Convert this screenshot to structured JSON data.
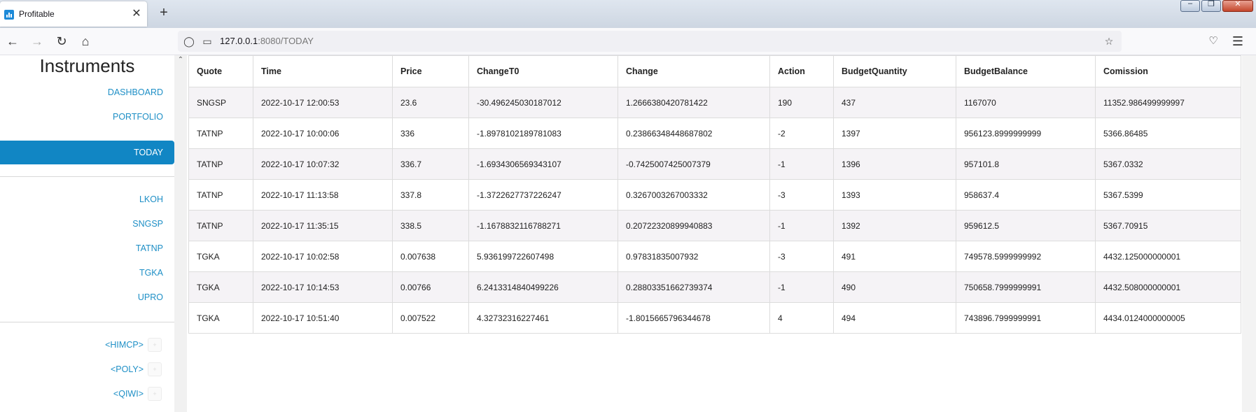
{
  "browser": {
    "tab_title": "Profitable",
    "tab_close_glyph": "✕",
    "new_tab_glyph": "+",
    "url_host": "127.0.0.1",
    "url_rest": ":8080/TODAY",
    "window_controls": {
      "minimize": "–",
      "restore": "❐",
      "close": "✕"
    }
  },
  "sidebar": {
    "title": "Instruments",
    "nav": [
      {
        "label": "DASHBOARD"
      },
      {
        "label": "PORTFOLIO"
      },
      {
        "label": "TODAY",
        "active": true
      }
    ],
    "instruments": [
      {
        "label": "LKOH"
      },
      {
        "label": "SNGSP"
      },
      {
        "label": "TATNP"
      },
      {
        "label": "TGKA"
      },
      {
        "label": "UPRO"
      }
    ],
    "extras": [
      {
        "label": "<HIMCP>",
        "mini": "+"
      },
      {
        "label": "<POLY>",
        "mini": "+"
      },
      {
        "label": "<QIWI>",
        "mini": "+"
      }
    ]
  },
  "table": {
    "columns": [
      "Quote",
      "Time",
      "Price",
      "ChangeT0",
      "Change",
      "Action",
      "BudgetQuantity",
      "BudgetBalance",
      "Comission"
    ],
    "rows": [
      [
        "SNGSP",
        "2022-10-17 12:00:53",
        "23.6",
        "-30.496245030187012",
        "1.2666380420781422",
        "190",
        "437",
        "1167070",
        "11352.986499999997"
      ],
      [
        "TATNP",
        "2022-10-17 10:00:06",
        "336",
        "-1.8978102189781083",
        "0.23866348448687802",
        "-2",
        "1397",
        "956123.8999999999",
        "5366.86485"
      ],
      [
        "TATNP",
        "2022-10-17 10:07:32",
        "336.7",
        "-1.6934306569343107",
        "-0.7425007425007379",
        "-1",
        "1396",
        "957101.8",
        "5367.0332"
      ],
      [
        "TATNP",
        "2022-10-17 11:13:58",
        "337.8",
        "-1.3722627737226247",
        "0.3267003267003332",
        "-3",
        "1393",
        "958637.4",
        "5367.5399"
      ],
      [
        "TATNP",
        "2022-10-17 11:35:15",
        "338.5",
        "-1.1678832116788271",
        "0.20722320899940883",
        "-1",
        "1392",
        "959612.5",
        "5367.70915"
      ],
      [
        "TGKA",
        "2022-10-17 10:02:58",
        "0.007638",
        "5.936199722607498",
        "0.97831835007932",
        "-3",
        "491",
        "749578.5999999992",
        "4432.125000000001"
      ],
      [
        "TGKA",
        "2022-10-17 10:14:53",
        "0.00766",
        "6.2413314840499226",
        "0.28803351662739374",
        "-1",
        "490",
        "750658.7999999991",
        "4432.508000000001"
      ],
      [
        "TGKA",
        "2022-10-17 10:51:40",
        "0.007522",
        "4.32732316227461",
        "-1.8015665796344678",
        "4",
        "494",
        "743896.7999999991",
        "4434.0124000000005"
      ]
    ]
  },
  "colors": {
    "accent": "#1186c4",
    "link": "#1e8fc6",
    "row_stripe": "#f5f3f6"
  }
}
